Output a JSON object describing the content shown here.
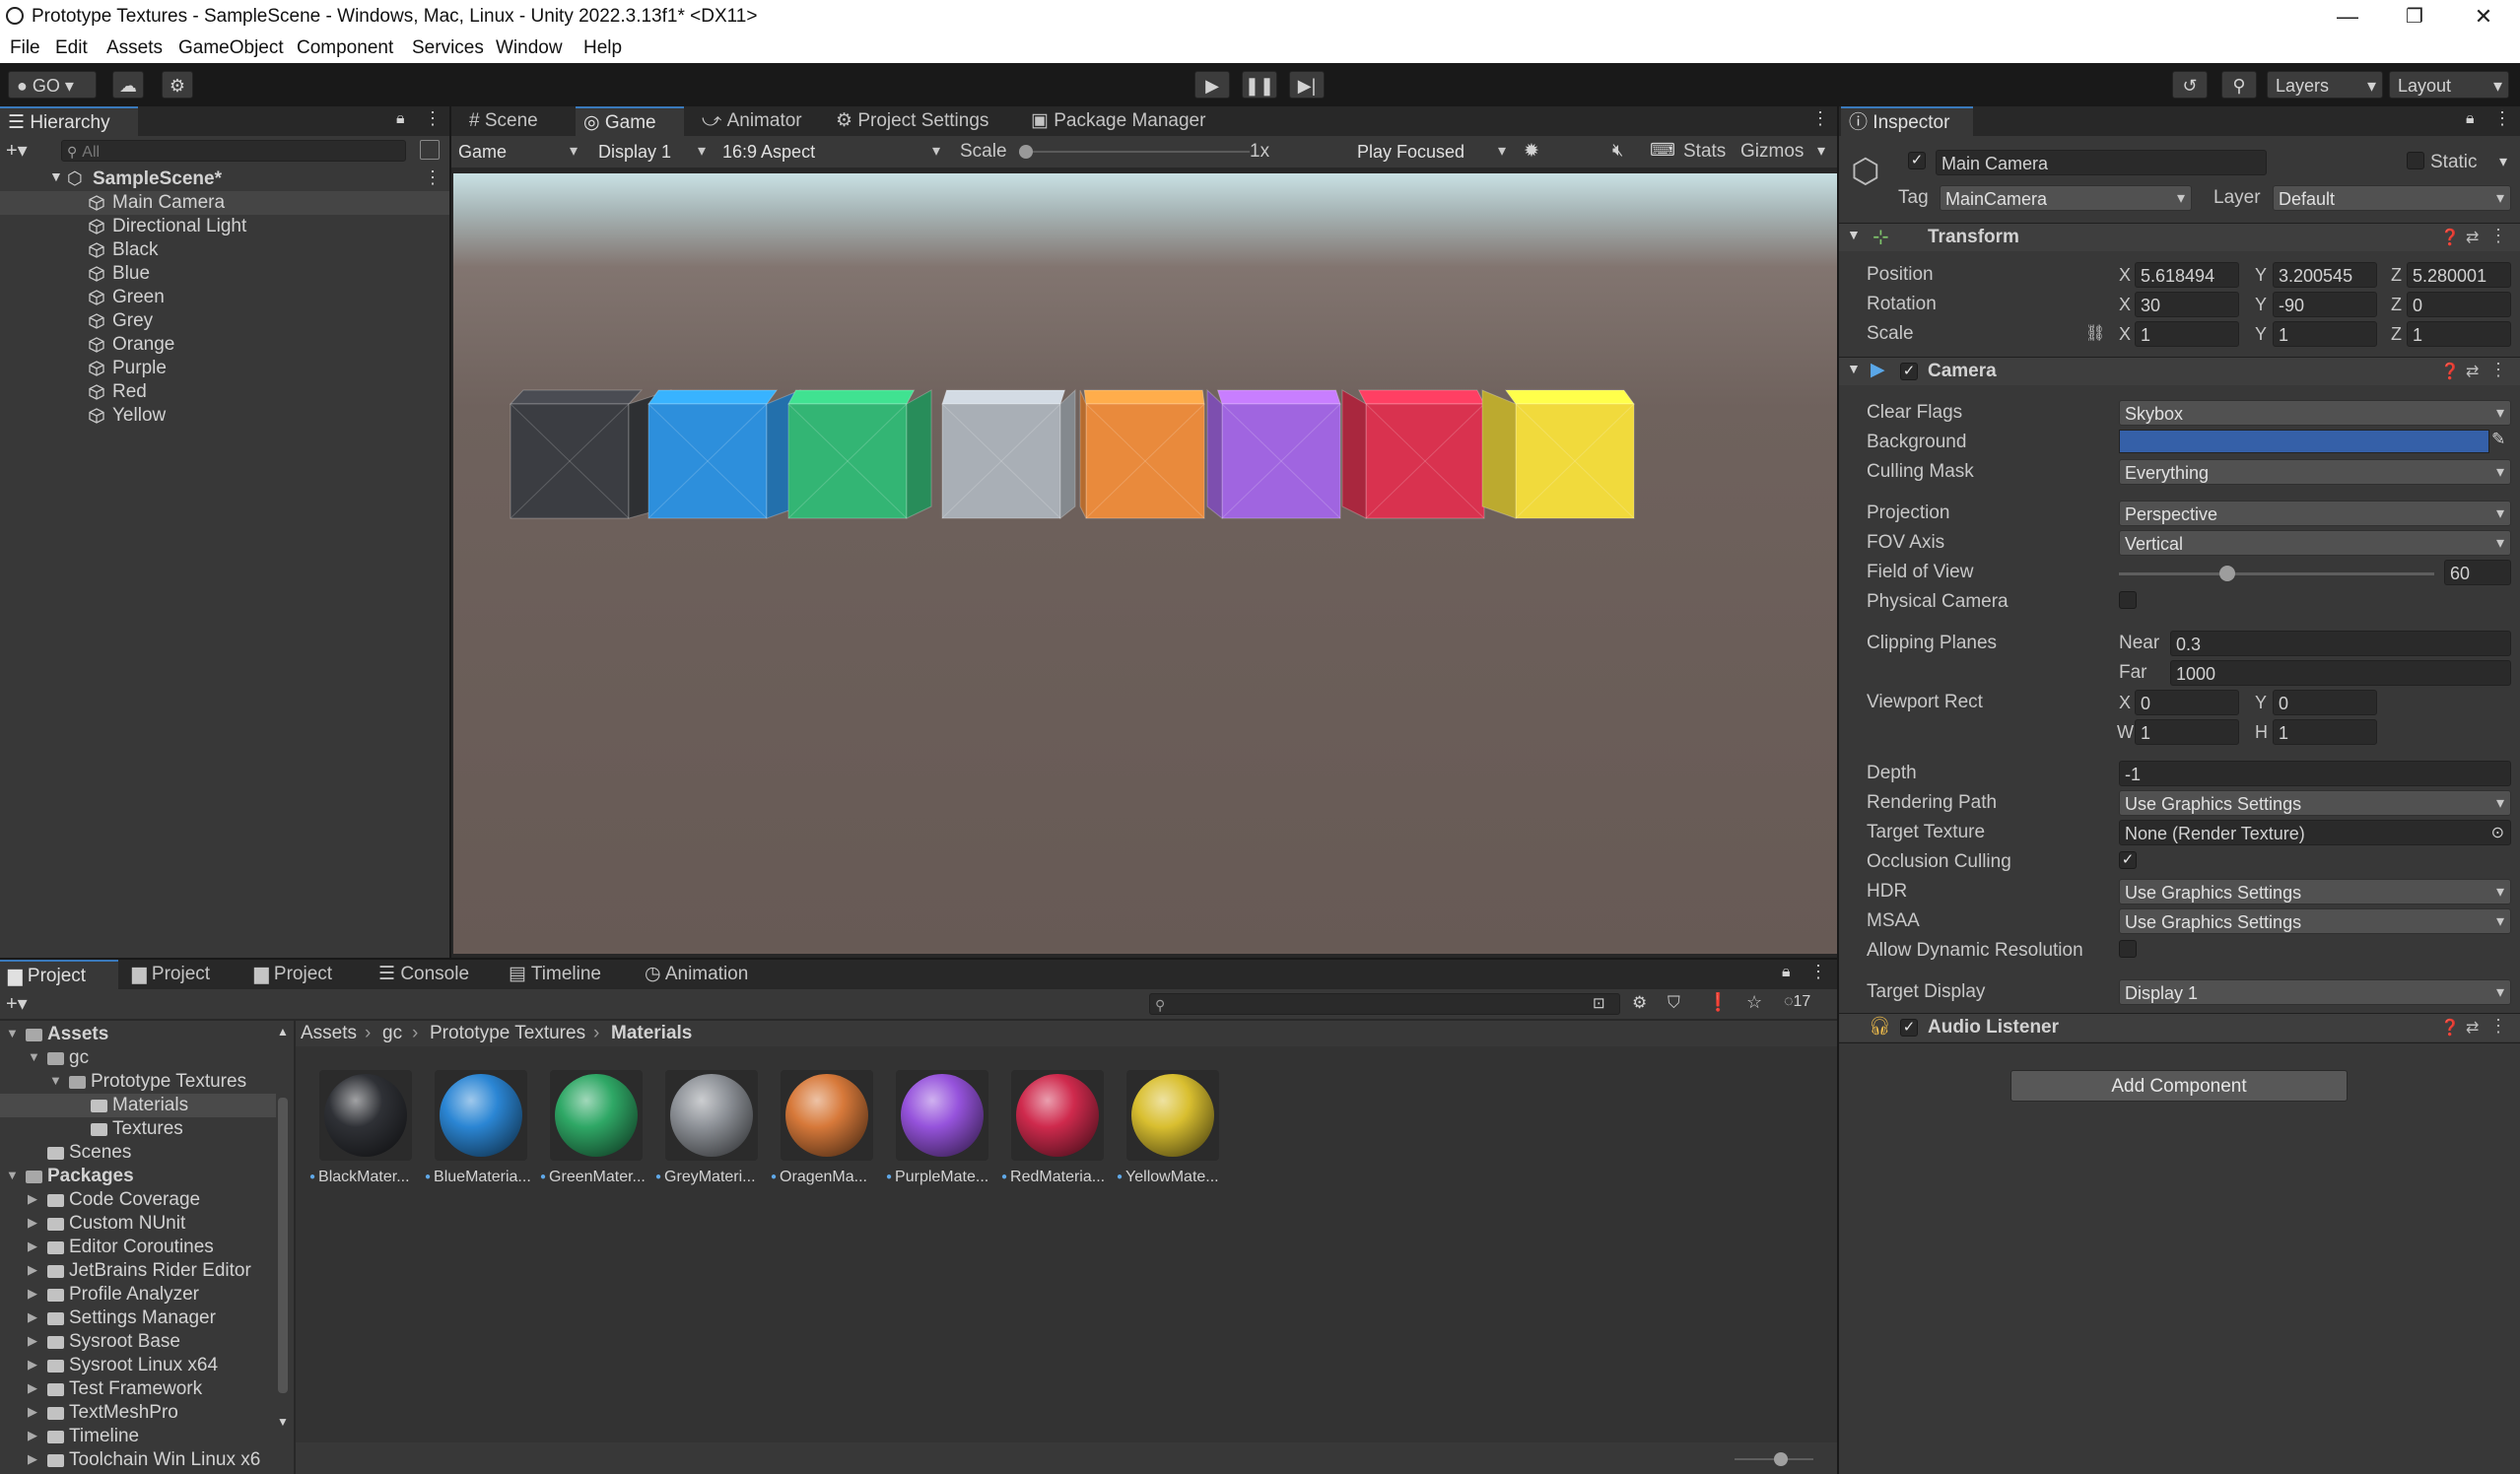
{
  "window": {
    "title": "Prototype Textures - SampleScene - Windows, Mac, Linux - Unity 2022.3.13f1* <DX11>",
    "minimize": "—",
    "maximize": "❐",
    "close": "✕"
  },
  "menu": [
    "File",
    "Edit",
    "Assets",
    "GameObject",
    "Component",
    "Services",
    "Window",
    "Help"
  ],
  "toolbar": {
    "account_label": "GO",
    "layers_label": "Layers",
    "layout_label": "Layout"
  },
  "hierarchy": {
    "tab_label": "Hierarchy",
    "search_placeholder": "All",
    "scene_name": "SampleScene*",
    "items": [
      "Main Camera",
      "Directional Light",
      "Black",
      "Blue",
      "Green",
      "Grey",
      "Orange",
      "Purple",
      "Red",
      "Yellow"
    ],
    "selected": "Main Camera"
  },
  "center_tabs": [
    "Scene",
    "Game",
    "Animator",
    "Project Settings",
    "Package Manager"
  ],
  "game_toolbar": {
    "view_mode": "Game",
    "display": "Display 1",
    "aspect": "16:9 Aspect",
    "scale_label": "Scale",
    "scale_value": "1x",
    "play_mode": "Play Focused",
    "stats": "Stats",
    "gizmos": "Gizmos"
  },
  "scene_cubes": [
    {
      "name": "Black",
      "color": "#3b3d42"
    },
    {
      "name": "Blue",
      "color": "#2d8fdc"
    },
    {
      "name": "Green",
      "color": "#33b574"
    },
    {
      "name": "Grey",
      "color": "#a9afb6"
    },
    {
      "name": "Orange",
      "color": "#e98a3c"
    },
    {
      "name": "Purple",
      "color": "#a065e0"
    },
    {
      "name": "Red",
      "color": "#d9324f"
    },
    {
      "name": "Yellow",
      "color": "#f1da3c"
    }
  ],
  "bottom_tabs": [
    "Project",
    "Project",
    "Project",
    "Console",
    "Timeline",
    "Animation"
  ],
  "project": {
    "hidden_count": "17",
    "breadcrumb": [
      "Assets",
      "gc",
      "Prototype Textures",
      "Materials"
    ],
    "tree": {
      "assets": "Assets",
      "gc": "gc",
      "prototype": "Prototype Textures",
      "materials": "Materials",
      "textures": "Textures",
      "scenes": "Scenes",
      "packages": "Packages",
      "package_items": [
        "Code Coverage",
        "Custom NUnit",
        "Editor Coroutines",
        "JetBrains Rider Editor",
        "Profile Analyzer",
        "Settings Manager",
        "Sysroot Base",
        "Sysroot Linux x64",
        "Test Framework",
        "TextMeshPro",
        "Timeline",
        "Toolchain Win Linux x6"
      ]
    },
    "assets": [
      {
        "label": "BlackMater...",
        "color": "#2f3136"
      },
      {
        "label": "BlueMateria...",
        "color": "#2b86d4"
      },
      {
        "label": "GreenMater...",
        "color": "#2fa866"
      },
      {
        "label": "GreyMateri...",
        "color": "#8e9298"
      },
      {
        "label": "OragenMa...",
        "color": "#d7793a"
      },
      {
        "label": "PurpleMate...",
        "color": "#9653dc"
      },
      {
        "label": "RedMateria...",
        "color": "#cf2a4d"
      },
      {
        "label": "YellowMate...",
        "color": "#d9bf30"
      }
    ]
  },
  "inspector": {
    "tab_label": "Inspector",
    "object_name": "Main Camera",
    "static_label": "Static",
    "tag_label": "Tag",
    "tag_value": "MainCamera",
    "layer_label": "Layer",
    "layer_value": "Default",
    "transform": {
      "title": "Transform",
      "position_label": "Position",
      "rotation_label": "Rotation",
      "scale_label": "Scale",
      "position": {
        "x": "5.618494",
        "y": "3.200545",
        "z": "5.280001"
      },
      "rotation": {
        "x": "30",
        "y": "-90",
        "z": "0"
      },
      "scale": {
        "x": "1",
        "y": "1",
        "z": "1"
      }
    },
    "camera": {
      "title": "Camera",
      "clear_flags_label": "Clear Flags",
      "clear_flags": "Skybox",
      "background_label": "Background",
      "background_color": "#3560a8",
      "culling_mask_label": "Culling Mask",
      "culling_mask": "Everything",
      "projection_label": "Projection",
      "projection": "Perspective",
      "fov_axis_label": "FOV Axis",
      "fov_axis": "Vertical",
      "fov_label": "Field of View",
      "fov": "60",
      "physical_label": "Physical Camera",
      "clipping_label": "Clipping Planes",
      "near_label": "Near",
      "near": "0.3",
      "far_label": "Far",
      "far": "1000",
      "viewport_label": "Viewport Rect",
      "vx": "0",
      "vy": "0",
      "vw": "1",
      "vh": "1",
      "depth_label": "Depth",
      "depth": "-1",
      "rendering_path_label": "Rendering Path",
      "rendering_path": "Use Graphics Settings",
      "target_texture_label": "Target Texture",
      "target_texture": "None (Render Texture)",
      "occlusion_label": "Occlusion Culling",
      "hdr_label": "HDR",
      "hdr": "Use Graphics Settings",
      "msaa_label": "MSAA",
      "msaa": "Use Graphics Settings",
      "dynres_label": "Allow Dynamic Resolution",
      "target_display_label": "Target Display",
      "target_display": "Display 1"
    },
    "audio_listener": {
      "title": "Audio Listener"
    },
    "add_component": "Add Component"
  }
}
